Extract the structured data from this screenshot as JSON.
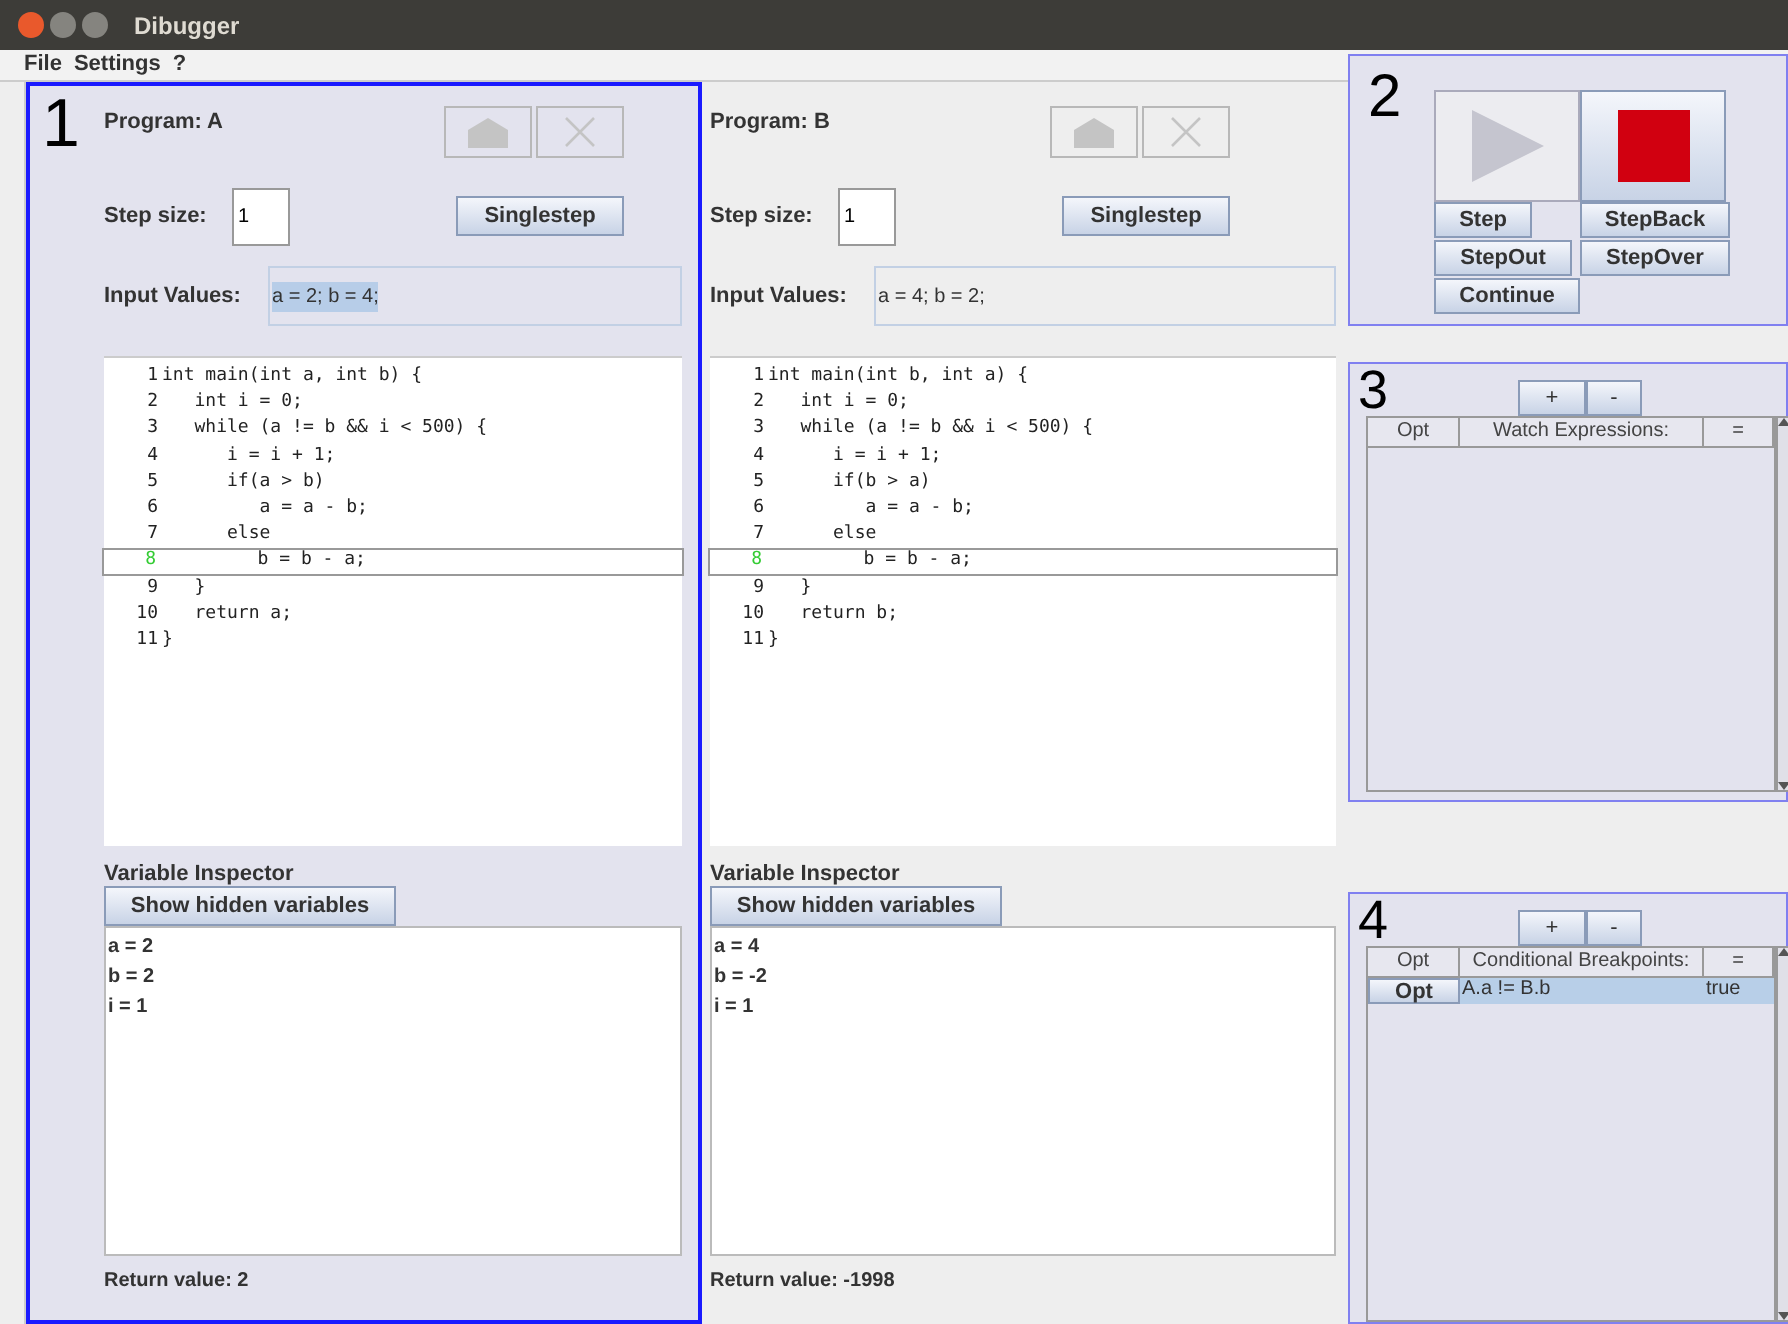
{
  "window": {
    "title": "Dibugger"
  },
  "menu": [
    {
      "label": "File"
    },
    {
      "label": "Settings"
    },
    {
      "label": "?"
    }
  ],
  "programs": [
    {
      "marker": "1",
      "title": "Program: A",
      "step_label": "Step size:",
      "step_size": "1",
      "singlestep": "Singlestep",
      "input_label": "Input Values:",
      "input_values": "a = 2; b = 4;",
      "input_selected": true,
      "focused": true,
      "code": [
        {
          "number": "1",
          "text": "int main(int a, int b) {",
          "current": false
        },
        {
          "number": "2",
          "text": "   int i = 0;",
          "current": false
        },
        {
          "number": "3",
          "text": "   while (a != b && i < 500) {",
          "current": false
        },
        {
          "number": "4",
          "text": "      i = i + 1;",
          "current": false
        },
        {
          "number": "5",
          "text": "      if(a > b)",
          "current": false
        },
        {
          "number": "6",
          "text": "         a = a - b;",
          "current": false
        },
        {
          "number": "7",
          "text": "      else",
          "current": false
        },
        {
          "number": "8",
          "text": "         b = b - a;",
          "current": true
        },
        {
          "number": "9",
          "text": "   }",
          "current": false
        },
        {
          "number": "10",
          "text": "   return a;",
          "current": false
        },
        {
          "number": "11",
          "text": "}",
          "current": false
        }
      ],
      "inspector_label": "Variable Inspector",
      "hidden_button": "Show hidden variables",
      "variables": [
        "a = 2",
        "b = 2",
        "i = 1"
      ],
      "return_value": "Return value: 2"
    },
    {
      "title": "Program: B",
      "step_label": "Step size:",
      "step_size": "1",
      "singlestep": "Singlestep",
      "input_label": "Input Values:",
      "input_values": "a = 4; b = 2;",
      "input_selected": false,
      "focused": false,
      "code": [
        {
          "number": "1",
          "text": "int main(int b, int a) {",
          "current": false
        },
        {
          "number": "2",
          "text": "   int i = 0;",
          "current": false
        },
        {
          "number": "3",
          "text": "   while (a != b && i < 500) {",
          "current": false
        },
        {
          "number": "4",
          "text": "      i = i + 1;",
          "current": false
        },
        {
          "number": "5",
          "text": "      if(b > a)",
          "current": false
        },
        {
          "number": "6",
          "text": "         a = a - b;",
          "current": false
        },
        {
          "number": "7",
          "text": "      else",
          "current": false
        },
        {
          "number": "8",
          "text": "         b = b - a;",
          "current": true
        },
        {
          "number": "9",
          "text": "   }",
          "current": false
        },
        {
          "number": "10",
          "text": "   return b;",
          "current": false
        },
        {
          "number": "11",
          "text": "}",
          "current": false
        }
      ],
      "inspector_label": "Variable Inspector",
      "hidden_button": "Show hidden variables",
      "variables": [
        "a = 4",
        "b = -2",
        "i = 1"
      ],
      "return_value": "Return value: -1998"
    }
  ],
  "control_panel": {
    "marker": "2",
    "buttons": [
      {
        "label": "Step"
      },
      {
        "label": "StepBack"
      },
      {
        "label": "StepOut"
      },
      {
        "label": "StepOver"
      },
      {
        "label": "Continue"
      }
    ]
  },
  "watch_panel": {
    "marker": "3",
    "add": "+",
    "remove": "-",
    "columns": [
      "Opt",
      "Watch Expressions:",
      "="
    ]
  },
  "breakpoint_panel": {
    "marker": "4",
    "add": "+",
    "remove": "-",
    "columns": [
      "Opt",
      "Conditional Breakpoints:",
      "="
    ],
    "rows": [
      {
        "opt": "Opt",
        "condition": "A.a != B.b",
        "value": "true",
        "selected": true
      }
    ]
  }
}
